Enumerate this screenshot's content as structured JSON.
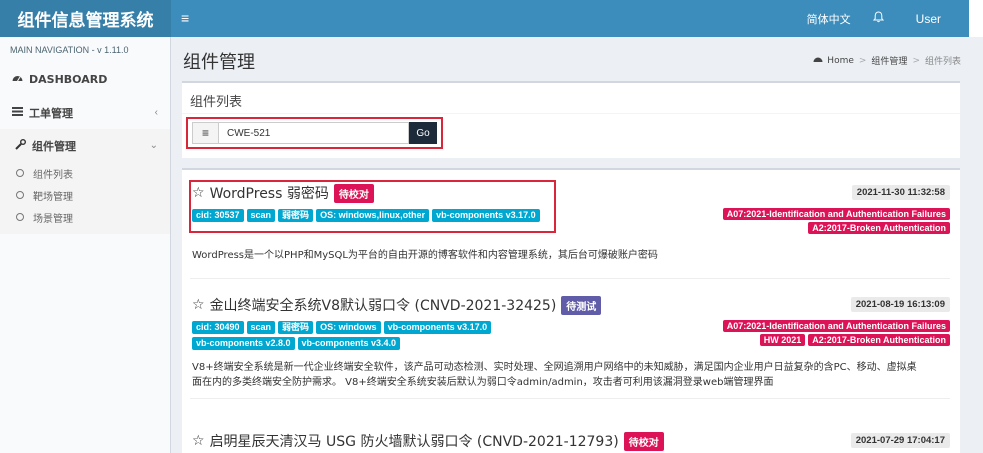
{
  "header": {
    "logo": "组件信息管理系统",
    "hamburger": "≡",
    "lang": "简体中文",
    "user": "User"
  },
  "sidebar": {
    "main_nav": "MAIN NAVIGATION  -  v 1.11.0",
    "items": [
      {
        "label": "DASHBOARD",
        "icon": "tachometer-icon"
      },
      {
        "label": "工单管理",
        "icon": "list-icon"
      },
      {
        "label": "组件管理",
        "icon": "wrench-icon"
      }
    ],
    "sub_items": [
      {
        "label": "组件列表"
      },
      {
        "label": "靶场管理"
      },
      {
        "label": "场景管理"
      }
    ]
  },
  "content": {
    "page_title": "组件管理",
    "breadcrumb": [
      "Home",
      "组件管理",
      "组件列表"
    ],
    "list_box_title": "组件列表",
    "search": {
      "value": "CWE-521",
      "button": "Go"
    },
    "items": [
      {
        "title": "WordPress 弱密码",
        "status": "待校对",
        "date": "2021-11-30 11:32:58",
        "tags": [
          "cid: 30537",
          "scan",
          "弱密码",
          "OS: windows,linux,other",
          "vb-components v3.17.0"
        ],
        "risks": [
          [
            "A07:2021-Identification and Authentication Failures"
          ],
          [
            "A2:2017-Broken Authentication"
          ]
        ],
        "description": "WordPress是一个以PHP和MySQL为平台的自由开源的博客软件和内容管理系统，其后台可爆破账户密码"
      },
      {
        "title": "金山终端安全系统V8默认弱口令 (CNVD-2021-32425)",
        "status": "待测试",
        "date": "2021-08-19 16:13:09",
        "tags": [
          "cid: 30490",
          "scan",
          "弱密码",
          "OS: windows",
          "vb-components v3.17.0",
          "vb-components v2.8.0",
          "vb-components v3.4.0"
        ],
        "risks": [
          [
            "A07:2021-Identification and Authentication Failures"
          ],
          [
            "HW 2021",
            "A2:2017-Broken Authentication"
          ]
        ],
        "description_lines": [
          "V8+终端安全系统是新一代企业终端安全软件，该产品可动态检测、实时处理、全网追溯用户网络中的未知威胁，满足国内企业用户日益复杂的含PC、移动、虚拟桌",
          "面在内的多类终端安全防护需求。 V8+终端安全系统安装后默认为弱口令admin/admin，攻击者可利用该漏洞登录web端管理界面"
        ]
      },
      {
        "title": "启明星辰天清汉马 USG 防火墙默认弱口令 (CNVD-2021-12793)",
        "status": "待校对",
        "date": "2021-07-29 17:04:17"
      }
    ]
  }
}
